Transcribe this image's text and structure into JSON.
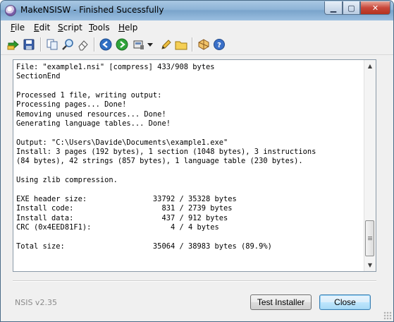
{
  "window": {
    "title": "MakeNSISW - Finished Sucessfully"
  },
  "title_buttons": {
    "minimize": "▁",
    "maximize": "▢",
    "close": "✕"
  },
  "menu": [
    {
      "hotkey": "F",
      "rest": "ile"
    },
    {
      "hotkey": "E",
      "rest": "dit"
    },
    {
      "hotkey": "S",
      "rest": "cript"
    },
    {
      "hotkey": "T",
      "rest": "ools"
    },
    {
      "hotkey": "H",
      "rest": "elp"
    }
  ],
  "toolbar_icons": [
    "recompile-icon",
    "save-icon",
    "copy-icon",
    "find-icon",
    "clear-icon",
    "back-icon",
    "forward-icon",
    "compressor-icon",
    "dropdown-arrow-icon",
    "edit-script-icon",
    "browse-script-icon",
    "settings-icon",
    "help-icon"
  ],
  "log_text": "File: \"example1.nsi\" [compress] 433/908 bytes\nSectionEnd\n\nProcessed 1 file, writing output:\nProcessing pages... Done!\nRemoving unused resources... Done!\nGenerating language tables... Done!\n\nOutput: \"C:\\Users\\Davide\\Documents\\example1.exe\"\nInstall: 3 pages (192 bytes), 1 section (1048 bytes), 3 instructions\n(84 bytes), 42 strings (857 bytes), 1 language table (230 bytes).\n\nUsing zlib compression.\n\nEXE header size:               33792 / 35328 bytes\nInstall code:                    831 / 2739 bytes\nInstall data:                    437 / 912 bytes\nCRC (0x4EED81F1):                  4 / 4 bytes\n\nTotal size:                    35064 / 38983 bytes (89.9%)",
  "scrollbar": {
    "up": "▲",
    "down": "▼",
    "position_fraction": 0.96
  },
  "footer": {
    "version": "NSIS v2.35",
    "test_button": "Test Installer",
    "close_button": "Close"
  }
}
